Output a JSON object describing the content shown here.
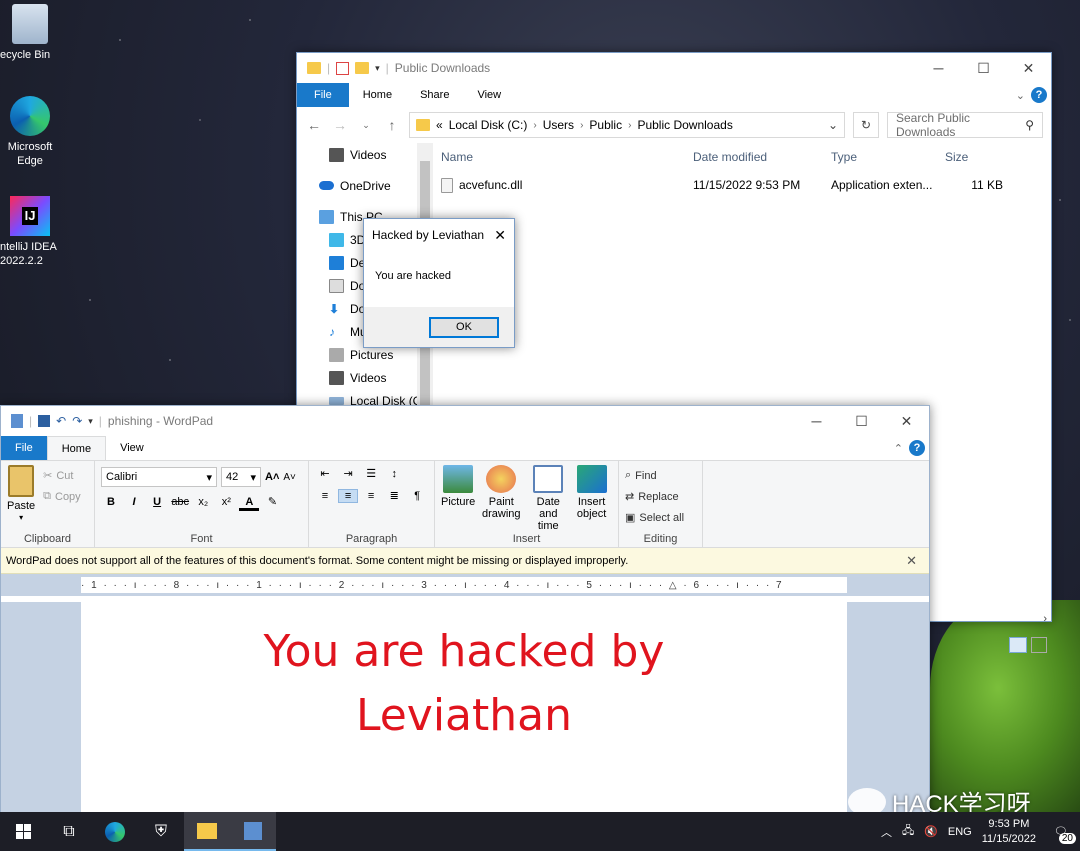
{
  "desktop": {
    "icons": [
      {
        "label": "ecycle Bin"
      },
      {
        "label": "Microsoft Edge"
      },
      {
        "label": "ntelliJ IDEA 2022.2.2"
      }
    ]
  },
  "explorer": {
    "title": "Public Downloads",
    "tabs": [
      "File",
      "Home",
      "Share",
      "View"
    ],
    "address": {
      "prefix": "«",
      "crumbs": [
        "Local Disk (C:)",
        "Users",
        "Public",
        "Public Downloads"
      ]
    },
    "search_placeholder": "Search Public Downloads",
    "nav_items": [
      "Videos",
      "OneDrive",
      "This PC",
      "3D",
      "Des",
      "Doc",
      "Dov",
      "Mu",
      "Pictures",
      "Videos",
      "Local Disk (C:)"
    ],
    "columns": [
      "Name",
      "Date modified",
      "Type",
      "Size"
    ],
    "files": [
      {
        "name": "acvefunc.dll",
        "date": "11/15/2022 9:53 PM",
        "type": "Application exten...",
        "size": "11 KB"
      }
    ]
  },
  "dialog": {
    "title": "Hacked by Leviathan",
    "message": "You are hacked",
    "ok_label": "OK"
  },
  "wordpad": {
    "title": "phishing - WordPad",
    "tabs": [
      "File",
      "Home",
      "View"
    ],
    "clipboard": {
      "paste": "Paste",
      "cut": "Cut",
      "copy": "Copy",
      "label": "Clipboard"
    },
    "font": {
      "family": "Calibri",
      "size": "42",
      "label": "Font"
    },
    "paragraph_label": "Paragraph",
    "insert": {
      "picture": "Picture",
      "paint": "Paint drawing",
      "datetime": "Date and time",
      "object": "Insert object",
      "label": "Insert"
    },
    "editing": {
      "find": "Find",
      "replace": "Replace",
      "select_all": "Select all",
      "label": "Editing"
    },
    "notice": "WordPad does not support all of the features of this document's format. Some content might be missing or displayed improperly.",
    "ruler": "· 1 · · · ı · · · 8 · · · ı · · · 1 · · · ı · · · 2 · · · ı · · · 3 · · · ı · · · 4 · · · ı · · · 5 · · · ı · · · △ · 6 · · · ı · · · 7",
    "doc_line1": "You are hacked by",
    "doc_line2": "Leviathan"
  },
  "watermark": "HACK学习呀",
  "taskbar": {
    "lang": "ENG",
    "time": "9:53 PM",
    "date": "11/15/2022",
    "notif_count": "20"
  },
  "colors": {
    "accent": "#1979ca",
    "doc_text": "#e0141e",
    "notice_bg": "#fcf9e0"
  }
}
